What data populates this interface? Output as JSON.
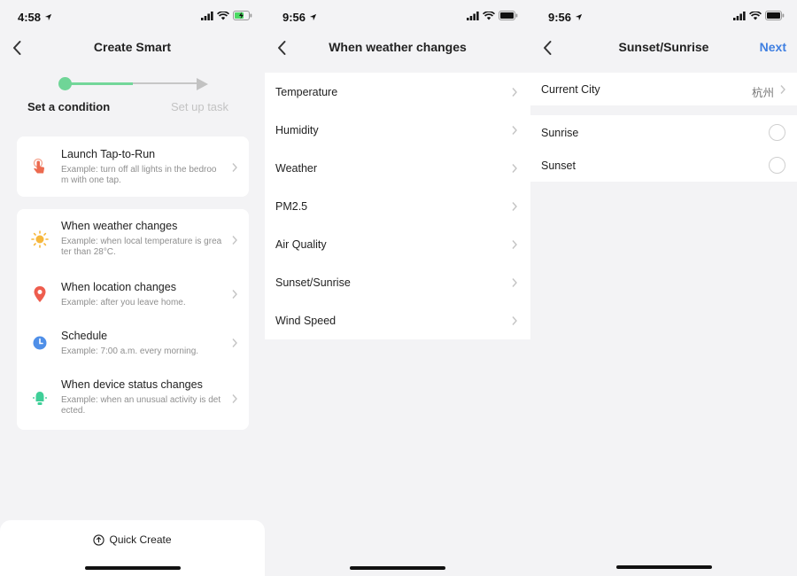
{
  "screens": {
    "create": {
      "time": "4:58",
      "title": "Create Smart",
      "steps": [
        "Set a condition",
        "Set up task"
      ],
      "launch": {
        "title": "Launch Tap-to-Run",
        "desc": "Example: turn off all lights in the bedroom with one tap."
      },
      "conditions": [
        {
          "title": "When weather changes",
          "desc": "Example: when local temperature is greater than 28°C.",
          "icon": "sun-icon"
        },
        {
          "title": "When location changes",
          "desc": "Example: after you leave home.",
          "icon": "location-pin-icon"
        },
        {
          "title": "Schedule",
          "desc": "Example: 7:00 a.m. every morning.",
          "icon": "clock-icon"
        },
        {
          "title": "When device status changes",
          "desc": "Example: when an unusual activity is detected.",
          "icon": "device-icon"
        }
      ],
      "quick_create": "Quick Create"
    },
    "weather": {
      "time": "9:56",
      "title": "When weather changes",
      "items": [
        "Temperature",
        "Humidity",
        "Weather",
        "PM2.5",
        "Air Quality",
        "Sunset/Sunrise",
        "Wind Speed"
      ]
    },
    "sun": {
      "time": "9:56",
      "title": "Sunset/Sunrise",
      "next": "Next",
      "city_label": "Current City",
      "city_value": "杭州",
      "options": [
        "Sunrise",
        "Sunset"
      ]
    }
  },
  "colors": {
    "accent": "#3f7fe1",
    "progress": "#6fd597"
  }
}
